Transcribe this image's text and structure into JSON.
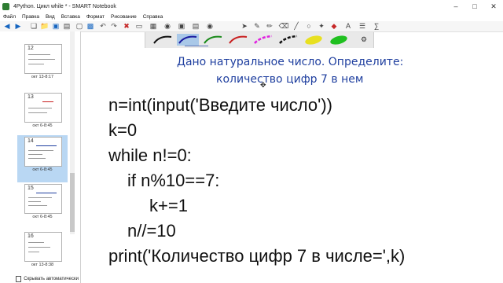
{
  "window": {
    "title": "4Python. Цикл while * - SMART Notebook"
  },
  "menu": [
    "Файл",
    "Правка",
    "Вид",
    "Вставка",
    "Формат",
    "Рисование",
    "Справка"
  ],
  "slides": [
    {
      "number": "12",
      "date": "окт 13-8:17"
    },
    {
      "number": "13",
      "date": "окт 6-8:45"
    },
    {
      "number": "14",
      "date": "окт 6-8:45"
    },
    {
      "number": "15",
      "date": "окт 6-8:45"
    },
    {
      "number": "16",
      "date": "окт 13-8:38"
    }
  ],
  "sidebar": {
    "autohide_label": "Скрывать автоматически"
  },
  "page": {
    "heading_line1": "Дано натуральное число. Определите:",
    "heading_line2": "количество цифр 7 в нем",
    "code": [
      "n=int(input('Введите число'))",
      "k=0",
      "while n!=0:",
      "if n%10==7:",
      "k+=1",
      "n//=10",
      "print('Количество цифр 7 в числе=',k)"
    ]
  },
  "colors": {
    "heading": "#1f3f9f",
    "selected_slide": "#b9d7f3",
    "pens": [
      "#111111",
      "#1a1aa0",
      "#1a8a1a",
      "#c82020",
      "#e020e0",
      "#111111",
      "#e8e020",
      "#20c020"
    ]
  }
}
